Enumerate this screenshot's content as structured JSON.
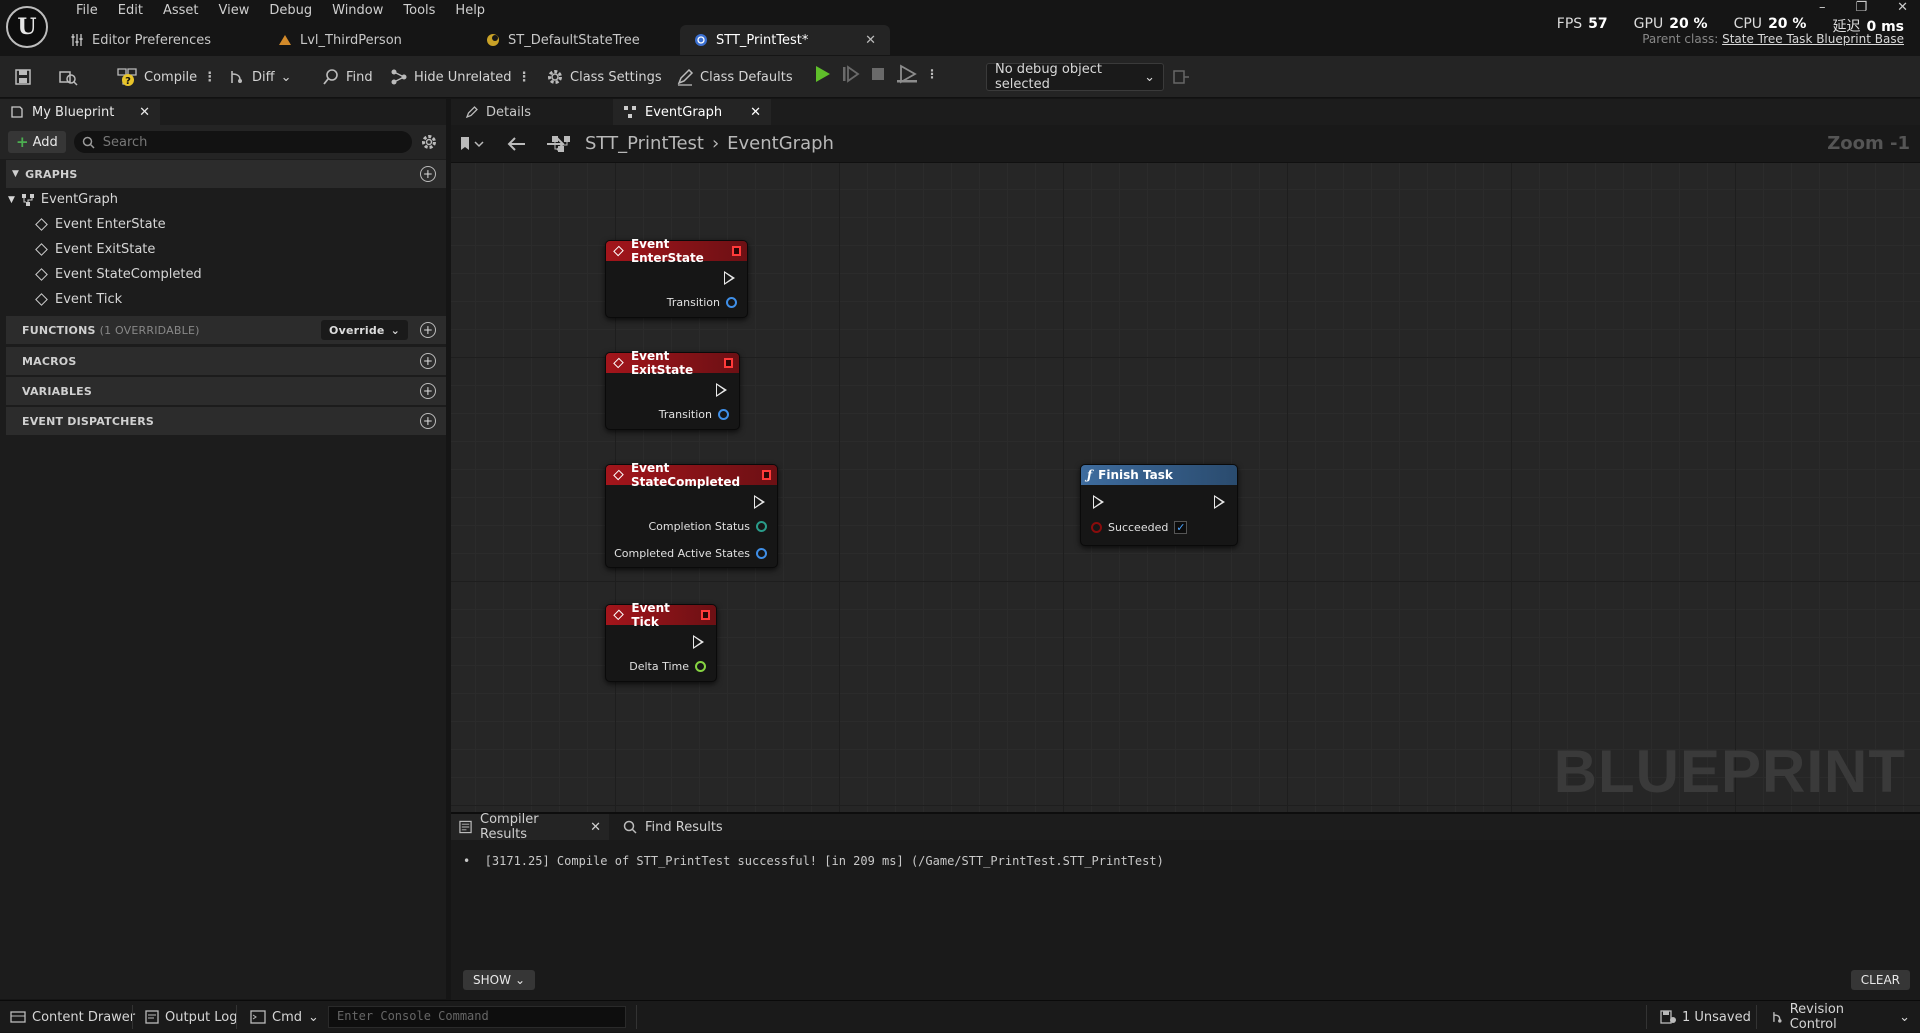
{
  "menu": [
    "File",
    "Edit",
    "Asset",
    "View",
    "Debug",
    "Window",
    "Tools",
    "Help"
  ],
  "tabs": [
    {
      "label": "Editor Preferences"
    },
    {
      "label": "Lvl_ThirdPerson"
    },
    {
      "label": "ST_DefaultStateTree"
    },
    {
      "label": "STT_PrintTest*",
      "active": true
    }
  ],
  "stats": {
    "fps_label": "FPS",
    "fps": "57",
    "gpu_label": "GPU",
    "gpu": "20 %",
    "cpu_label": "CPU",
    "cpu": "20 %",
    "latency_label": "延迟",
    "latency": "0 ms"
  },
  "parent_class": {
    "label": "Parent class:",
    "value": "State Tree Task Blueprint Base"
  },
  "toolbar": {
    "compile": "Compile",
    "diff": "Diff",
    "find": "Find",
    "hide_unrelated": "Hide Unrelated",
    "class_settings": "Class Settings",
    "class_defaults": "Class Defaults",
    "debug_object": "No debug object selected"
  },
  "left_panel": {
    "tab": "My Blueprint",
    "add": "Add",
    "search_placeholder": "Search",
    "graphs_label": "GRAPHS",
    "eventgraph": "EventGraph",
    "events": [
      "Event EnterState",
      "Event ExitState",
      "Event StateCompleted",
      "Event Tick"
    ],
    "functions_label": "FUNCTIONS",
    "functions_sub": "(1 OVERRIDABLE)",
    "override": "Override",
    "macros_label": "MACROS",
    "variables_label": "VARIABLES",
    "dispatchers_label": "EVENT DISPATCHERS"
  },
  "graph": {
    "tabs": [
      "Details",
      "EventGraph"
    ],
    "breadcrumb": [
      "STT_PrintTest",
      "EventGraph"
    ],
    "zoom": "Zoom -1",
    "watermark": "BLUEPRINT",
    "nodes": {
      "enter": {
        "title": "Event EnterState",
        "pin": "Transition"
      },
      "exit": {
        "title": "Event ExitState",
        "pin": "Transition"
      },
      "completed": {
        "title": "Event StateCompleted",
        "pin1": "Completion Status",
        "pin2": "Completed Active States"
      },
      "tick": {
        "title": "Event Tick",
        "pin": "Delta Time"
      },
      "finish": {
        "title": "Finish Task",
        "pin": "Succeeded",
        "checked": true
      }
    }
  },
  "bottom": {
    "tabs": [
      "Compiler Results",
      "Find Results"
    ],
    "log": "[3171.25] Compile of STT_PrintTest successful! [in 209 ms] (/Game/STT_PrintTest.STT_PrintTest)",
    "show": "SHOW",
    "clear": "CLEAR"
  },
  "statusbar": {
    "content_drawer": "Content Drawer",
    "output_log": "Output Log",
    "cmd": "Cmd",
    "console_placeholder": "Enter Console Command",
    "unsaved": "1 Unsaved",
    "revision": "Revision Control"
  },
  "colors": {
    "event_header": "#a3151b",
    "func_header": "#3e6c9e",
    "accent_green": "#4caf50"
  }
}
